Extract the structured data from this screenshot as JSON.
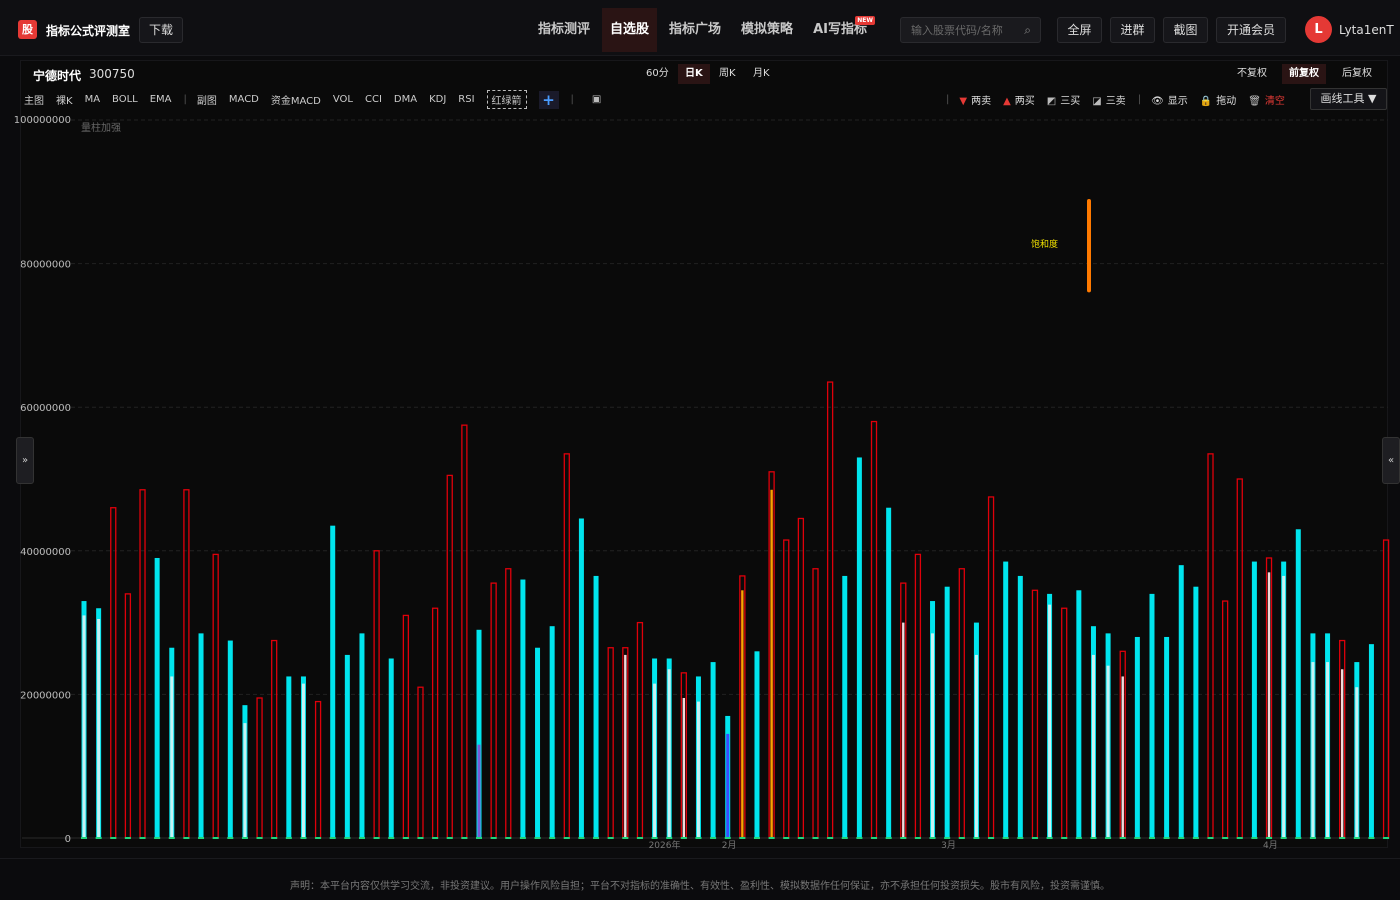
{
  "header": {
    "logo_text": "股",
    "app_title": "指标公式评测室",
    "download": "下载",
    "nav": [
      {
        "label": "指标测评",
        "active": false
      },
      {
        "label": "自选股",
        "active": true
      },
      {
        "label": "指标广场",
        "active": false
      },
      {
        "label": "模拟策略",
        "active": false
      },
      {
        "label": "AI写指标",
        "active": false,
        "badge": "NEW"
      }
    ],
    "search_placeholder": "输入股票代码/名称",
    "buttons": [
      "全屏",
      "进群",
      "截图",
      "开通会员"
    ],
    "avatar_letter": "L",
    "username": "Lyta1enT"
  },
  "stock": {
    "name": "宁德时代",
    "code": "300750"
  },
  "periods": [
    {
      "label": "60分",
      "active": false
    },
    {
      "label": "日K",
      "active": true
    },
    {
      "label": "周K",
      "active": false
    },
    {
      "label": "月K",
      "active": false
    }
  ],
  "adjust": [
    {
      "label": "不复权",
      "active": false
    },
    {
      "label": "前复权",
      "active": true
    },
    {
      "label": "后复权",
      "active": false
    }
  ],
  "indicators_main": [
    "主图",
    "裸K",
    "MA",
    "BOLL",
    "EMA"
  ],
  "indicators_sub": [
    "副图",
    "MACD",
    "资金MACD",
    "VOL",
    "CCI",
    "DMA",
    "KDJ",
    "RSI"
  ],
  "indicator_active": "红绿箭",
  "right_tools": [
    {
      "icon": "▼",
      "color": "#e53935",
      "label": "两卖"
    },
    {
      "icon": "▲",
      "color": "#e53935",
      "label": "两买"
    },
    {
      "icon": "◩",
      "color": "#bbbbbb",
      "label": "三买"
    },
    {
      "icon": "◪",
      "color": "#bbbbbb",
      "label": "三卖"
    },
    {
      "icon": "👁",
      "color": "#dddddd",
      "label": "显示"
    },
    {
      "icon": "🔒",
      "color": "#f0c040",
      "label": "拖动"
    },
    {
      "icon": "🗑",
      "color": "#bbbbbb",
      "label": "清空"
    }
  ],
  "draw_tools": "画线工具 ▼",
  "side_left": "»",
  "side_right": "«",
  "footer": "声明：本平台内容仅供学习交流，非投资建议。用户操作风险自担；平台不对指标的准确性、有效性、盈利性、模拟数据作任何保证，亦不承担任何投资损失。股市有风险，投资需谨慎。",
  "chart_data": {
    "type": "bar",
    "title": "量柱加强",
    "annotation": {
      "label": "饱和度",
      "low": 76000000,
      "high": 89000000
    },
    "ylim": [
      0,
      100000000
    ],
    "yticks": [
      0,
      20000000,
      40000000,
      60000000,
      80000000,
      100000000
    ],
    "xlabels": [
      {
        "index": 39,
        "label": "2026年"
      },
      {
        "index": 44,
        "label": "2月"
      },
      {
        "index": 59,
        "label": "3月"
      },
      {
        "index": 81,
        "label": "4月"
      }
    ],
    "colors": {
      "up": "#e0000a",
      "down": "#00e5ee",
      "inner": "#e8f4f4",
      "grid": "#222222"
    },
    "bars": [
      {
        "v": 33000000,
        "t": "d",
        "w": 31000000
      },
      {
        "v": 32000000,
        "t": "d",
        "w": 30500000
      },
      {
        "v": 46000000,
        "t": "u"
      },
      {
        "v": 34000000,
        "t": "u"
      },
      {
        "v": 48500000,
        "t": "u"
      },
      {
        "v": 39000000,
        "t": "d"
      },
      {
        "v": 26500000,
        "t": "d",
        "w": 22500000
      },
      {
        "v": 48500000,
        "t": "u"
      },
      {
        "v": 28500000,
        "t": "d"
      },
      {
        "v": 39500000,
        "t": "u"
      },
      {
        "v": 27500000,
        "t": "d"
      },
      {
        "v": 18500000,
        "t": "d",
        "w": 16000000
      },
      {
        "v": 19500000,
        "t": "u"
      },
      {
        "v": 27500000,
        "t": "u"
      },
      {
        "v": 22500000,
        "t": "d"
      },
      {
        "v": 22500000,
        "t": "d",
        "w": 21500000
      },
      {
        "v": 19000000,
        "t": "u"
      },
      {
        "v": 43500000,
        "t": "d"
      },
      {
        "v": 25500000,
        "t": "d"
      },
      {
        "v": 28500000,
        "t": "d"
      },
      {
        "v": 40000000,
        "t": "u"
      },
      {
        "v": 25000000,
        "t": "d"
      },
      {
        "v": 31000000,
        "t": "u"
      },
      {
        "v": 21000000,
        "t": "u"
      },
      {
        "v": 32000000,
        "t": "u"
      },
      {
        "v": 50500000,
        "t": "u"
      },
      {
        "v": 57500000,
        "t": "u"
      },
      {
        "v": 29000000,
        "t": "d",
        "w": 13000000,
        "wc": "#7b5ad6"
      },
      {
        "v": 35500000,
        "t": "u"
      },
      {
        "v": 37500000,
        "t": "u"
      },
      {
        "v": 36000000,
        "t": "d"
      },
      {
        "v": 26500000,
        "t": "d"
      },
      {
        "v": 29500000,
        "t": "d"
      },
      {
        "v": 53500000,
        "t": "u"
      },
      {
        "v": 44500000,
        "t": "d"
      },
      {
        "v": 36500000,
        "t": "d"
      },
      {
        "v": 26500000,
        "t": "u"
      },
      {
        "v": 26500000,
        "t": "u",
        "w": 25500000
      },
      {
        "v": 30000000,
        "t": "u"
      },
      {
        "v": 25000000,
        "t": "d",
        "w": 21500000
      },
      {
        "v": 25000000,
        "t": "d",
        "w": 23500000
      },
      {
        "v": 23000000,
        "t": "u",
        "w": 19500000
      },
      {
        "v": 22500000,
        "t": "d",
        "w": 19000000
      },
      {
        "v": 24500000,
        "t": "d"
      },
      {
        "v": 17000000,
        "t": "d",
        "w": 14500000,
        "wc": "#3a4cff"
      },
      {
        "v": 36500000,
        "t": "u",
        "w": 34500000,
        "wc": "#ffa000"
      },
      {
        "v": 26000000,
        "t": "d"
      },
      {
        "v": 51000000,
        "t": "u",
        "w": 48500000,
        "wc": "#ffa000"
      },
      {
        "v": 41500000,
        "t": "u"
      },
      {
        "v": 44500000,
        "t": "u"
      },
      {
        "v": 37500000,
        "t": "u"
      },
      {
        "v": 63500000,
        "t": "u"
      },
      {
        "v": 36500000,
        "t": "d"
      },
      {
        "v": 53000000,
        "t": "d"
      },
      {
        "v": 58000000,
        "t": "u"
      },
      {
        "v": 46000000,
        "t": "d"
      },
      {
        "v": 35500000,
        "t": "u",
        "w": 30000000
      },
      {
        "v": 39500000,
        "t": "u"
      },
      {
        "v": 33000000,
        "t": "d",
        "w": 28500000
      },
      {
        "v": 35000000,
        "t": "d"
      },
      {
        "v": 37500000,
        "t": "u"
      },
      {
        "v": 30000000,
        "t": "d",
        "w": 25500000
      },
      {
        "v": 47500000,
        "t": "u"
      },
      {
        "v": 38500000,
        "t": "d"
      },
      {
        "v": 36500000,
        "t": "d"
      },
      {
        "v": 34500000,
        "t": "u"
      },
      {
        "v": 34000000,
        "t": "d",
        "w": 32500000
      },
      {
        "v": 32000000,
        "t": "u"
      },
      {
        "v": 34500000,
        "t": "d"
      },
      {
        "v": 29500000,
        "t": "d",
        "w": 25500000
      },
      {
        "v": 28500000,
        "t": "d",
        "w": 24000000
      },
      {
        "v": 26000000,
        "t": "u",
        "w": 22500000
      },
      {
        "v": 28000000,
        "t": "d"
      },
      {
        "v": 34000000,
        "t": "d"
      },
      {
        "v": 28000000,
        "t": "d"
      },
      {
        "v": 38000000,
        "t": "d"
      },
      {
        "v": 35000000,
        "t": "d"
      },
      {
        "v": 53500000,
        "t": "u"
      },
      {
        "v": 33000000,
        "t": "u"
      },
      {
        "v": 50000000,
        "t": "u"
      },
      {
        "v": 38500000,
        "t": "d"
      },
      {
        "v": 39000000,
        "t": "u",
        "w": 37000000
      },
      {
        "v": 38500000,
        "t": "d",
        "w": 36500000
      },
      {
        "v": 43000000,
        "t": "d"
      },
      {
        "v": 28500000,
        "t": "d",
        "w": 24500000
      },
      {
        "v": 28500000,
        "t": "d",
        "w": 24500000
      },
      {
        "v": 27500000,
        "t": "u",
        "w": 23500000
      },
      {
        "v": 24500000,
        "t": "d",
        "w": 21000000
      },
      {
        "v": 27000000,
        "t": "d"
      },
      {
        "v": 41500000,
        "t": "u"
      }
    ]
  }
}
